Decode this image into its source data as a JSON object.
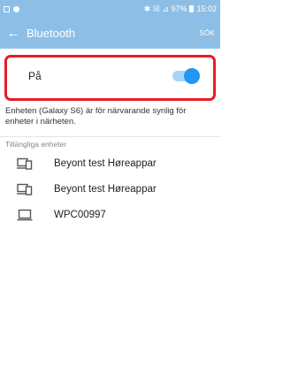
{
  "status_bar": {
    "signal_info": "✱ ☒ ⊿ 97%",
    "time": "15:02"
  },
  "app_bar": {
    "back_glyph": "←",
    "title": "Bluetooth",
    "search_label": "SÖK"
  },
  "toggle": {
    "label": "På",
    "state": "on"
  },
  "description": "Enheten (Galaxy S6) är för närvarande synlig för enheter i närheten.",
  "section_header": "Tillängliga enheter",
  "devices": [
    {
      "name": "Beyont test Høreappar",
      "icon": "devices-icon"
    },
    {
      "name": "Beyont test Høreappar",
      "icon": "devices-icon"
    },
    {
      "name": "WPC00997",
      "icon": "laptop-icon"
    }
  ],
  "colors": {
    "app_bar": "#8dbfe6",
    "toggle_accent": "#2196f3",
    "highlight": "#e81c24"
  }
}
